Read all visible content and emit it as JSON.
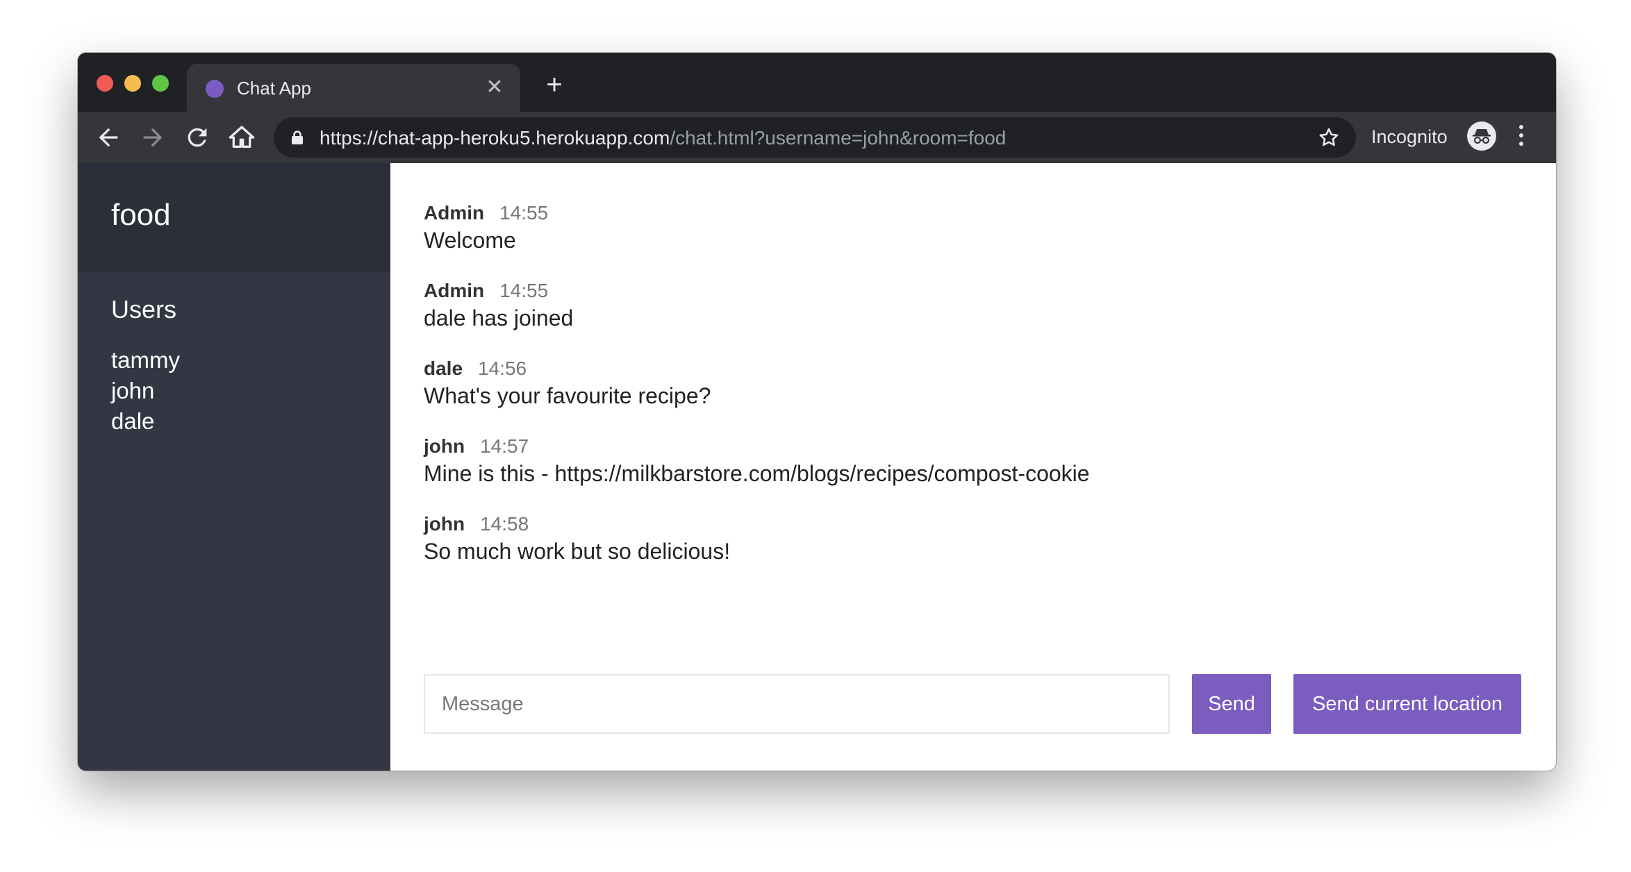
{
  "browser": {
    "tab": {
      "title": "Chat App",
      "favicon_color": "#7c5cc4"
    },
    "address": {
      "host": "https://chat-app-heroku5.herokuapp.com",
      "path": "/chat.html?username=john&room=food"
    },
    "incognito_label": "Incognito"
  },
  "sidebar": {
    "room": "food",
    "users_title": "Users",
    "users": [
      "tammy",
      "john",
      "dale"
    ]
  },
  "messages": [
    {
      "name": "Admin",
      "time": "14:55",
      "text": "Welcome"
    },
    {
      "name": "Admin",
      "time": "14:55",
      "text": "dale has joined"
    },
    {
      "name": "dale",
      "time": "14:56",
      "text": "What's your favourite recipe?"
    },
    {
      "name": "john",
      "time": "14:57",
      "text": "Mine is this - https://milkbarstore.com/blogs/recipes/compost-cookie"
    },
    {
      "name": "john",
      "time": "14:58",
      "text": "So much work but so delicious!"
    }
  ],
  "compose": {
    "placeholder": "Message",
    "send_label": "Send",
    "location_label": "Send current location"
  },
  "colors": {
    "accent": "#7c5cbf",
    "sidebar_bg": "#333744",
    "sidebar_header_bg": "#2c2f3a"
  }
}
